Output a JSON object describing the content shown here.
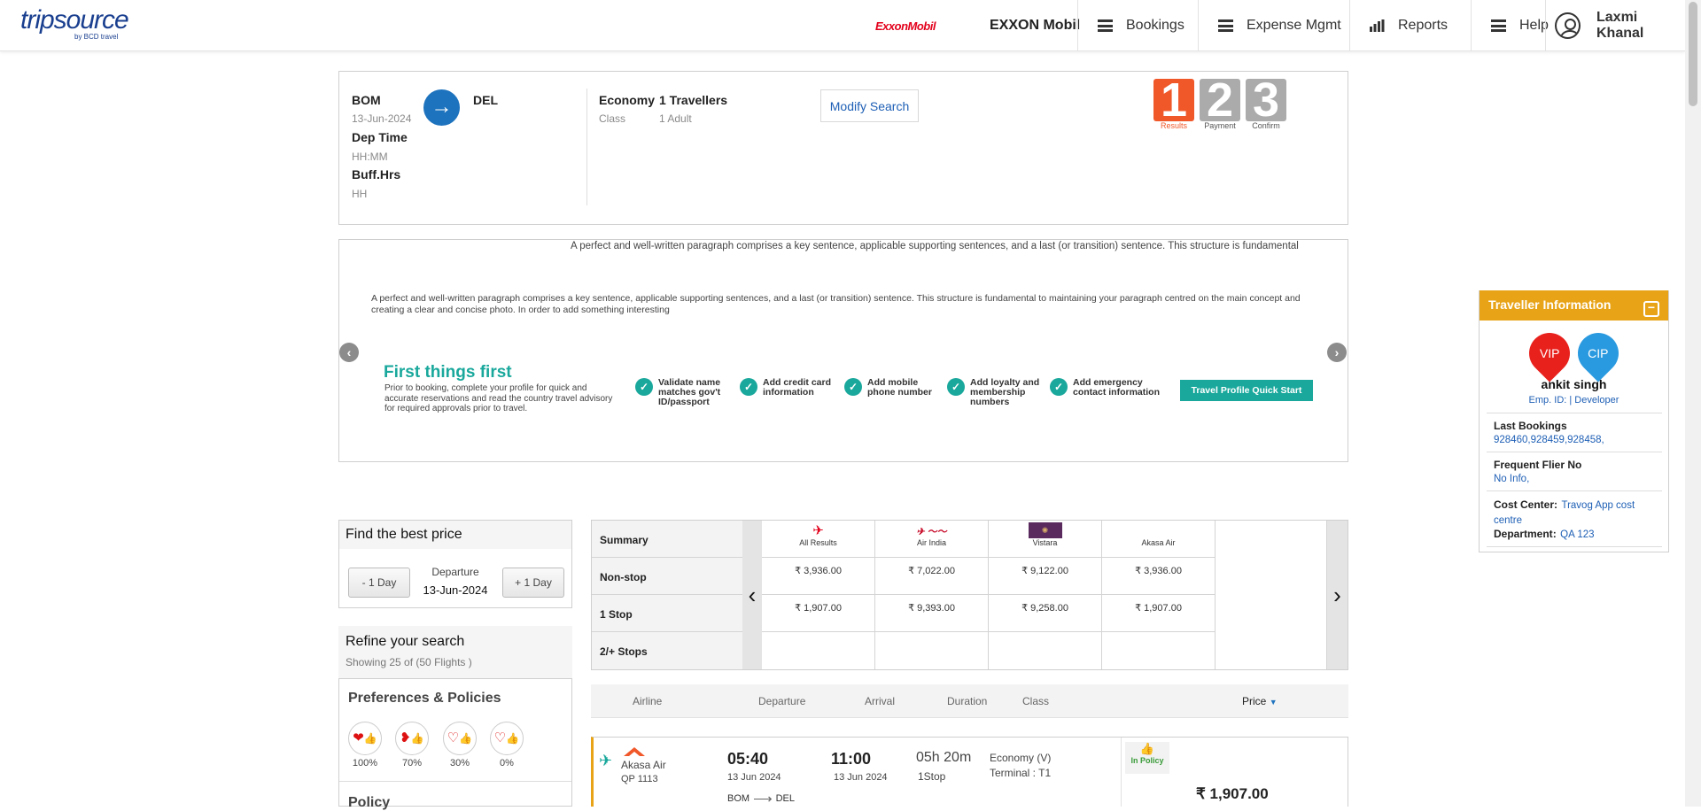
{
  "header": {
    "logo": "tripsource",
    "logo_sub": "by BCD travel",
    "company_logo": "ExxonMobil",
    "company_name": "EXXON Mobil",
    "nav": [
      {
        "label": "Bookings",
        "icon": "menu-icon"
      },
      {
        "label": "Expense Mgmt",
        "icon": "menu-icon"
      },
      {
        "label": "Reports",
        "icon": "bar-chart-icon"
      },
      {
        "label": "Help",
        "icon": "menu-icon"
      }
    ],
    "user_name": "Laxmi Khanal"
  },
  "search": {
    "from": "BOM",
    "date": "13-Jun-2024",
    "to": "DEL",
    "dep_time_label": "Dep Time",
    "dep_time_placeholder": "HH:MM",
    "buff_label": "Buff.Hrs",
    "buff_placeholder": "HH",
    "cabin": "Economy",
    "cabin_sub": "Class",
    "travellers": "1 Travellers",
    "travellers_sub": "1 Adult",
    "modify_label": "Modify Search",
    "steps": [
      {
        "num": "1",
        "label": "Results",
        "color": "#f0582a"
      },
      {
        "num": "2",
        "label": "Payment",
        "color": "#a8a8a8"
      },
      {
        "num": "3",
        "label": "Confirm",
        "color": "#a8a8a8"
      }
    ]
  },
  "banner": {
    "marquee": "A perfect and well-written paragraph comprises a key sentence, applicable supporting sentences, and a last (or transition) sentence. This structure is fundamental",
    "paragraph": "A perfect and well-written paragraph comprises a key sentence, applicable supporting sentences, and a last (or transition) sentence. This structure is fundamental to maintaining your paragraph centred on the main concept and creating a clear and concise photo. In order to add something interesting",
    "promo_title": "First things first",
    "promo_text": "Prior to booking, complete your profile for quick and accurate reservations and read the country travel advisory for required approvals prior to travel.",
    "checks": [
      "Validate name matches gov't ID/passport",
      "Add credit card information",
      "Add mobile phone number",
      "Add loyalty and membership numbers",
      "Add emergency contact information"
    ],
    "cta": "Travel Profile Quick Start"
  },
  "sidebar": {
    "best_price_title": "Find the best price",
    "minus_day": "- 1 Day",
    "plus_day": "+ 1 Day",
    "departure_label": "Departure",
    "departure_date": "13-Jun-2024",
    "refine_title": "Refine your search",
    "refine_sub": "Showing 25 of (50 Flights )",
    "prefs_title": "Preferences & Policies",
    "prefs": [
      "100%",
      "70%",
      "30%",
      "0%"
    ],
    "policy_title": "Policy"
  },
  "matrix": {
    "row_labels": [
      "Summary",
      "Non-stop",
      "1 Stop",
      "2/+ Stops"
    ],
    "airlines": [
      "All Results",
      "Air India",
      "Vistara",
      "Akasa Air"
    ],
    "nonstop": [
      "₹ 3,936.00",
      "₹ 7,022.00",
      "₹ 9,122.00",
      "₹ 3,936.00"
    ],
    "onestop": [
      "₹ 1,907.00",
      "₹ 9,393.00",
      "₹ 9,258.00",
      "₹ 1,907.00"
    ]
  },
  "results_header": {
    "airline": "Airline",
    "departure": "Departure",
    "arrival": "Arrival",
    "duration": "Duration",
    "class": "Class",
    "price": "Price"
  },
  "flight": {
    "airline": "Akasa Air",
    "code": "QP  1113",
    "dep_time": "05:40",
    "dep_date": "13 Jun 2024",
    "arr_time": "11:00",
    "arr_date": "13 Jun 2024",
    "duration": "05h 20m",
    "stops": "1Stop",
    "cabin": "Economy (V)",
    "terminal": "Terminal : T1",
    "from": "BOM",
    "to": "DEL",
    "policy": "In Policy",
    "price": "₹ 1,907.00"
  },
  "traveller": {
    "title": "Traveller Information",
    "badges": [
      "VIP",
      "CIP"
    ],
    "name": "ankit singh",
    "emp_id": "Emp. ID: | Developer",
    "last_bookings_label": "Last Bookings",
    "last_bookings": "928460,928459,928458,",
    "ff_label": "Frequent Flier No",
    "ff_value": "No Info,",
    "cost_center_label": "Cost Center",
    "cost_center_value": "Travog App cost centre",
    "department_label": "Department",
    "department_value": "QA 123"
  }
}
